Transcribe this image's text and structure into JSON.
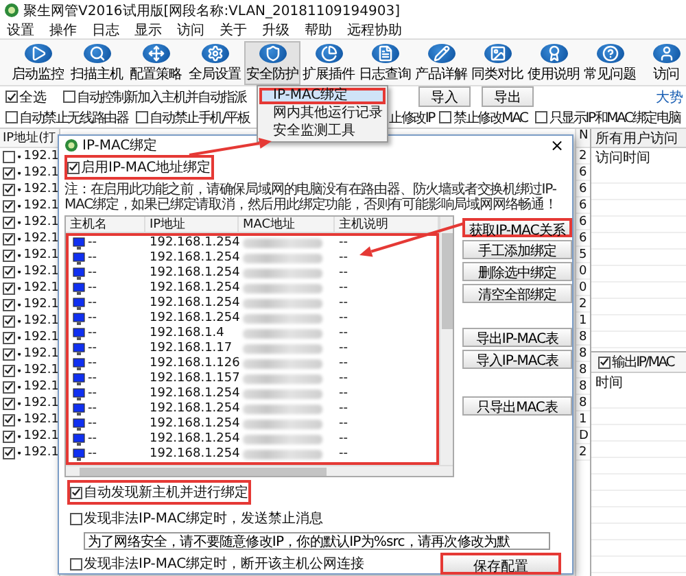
{
  "window": {
    "title": "聚生网管V2016试用版[网段名称:VLAN_20181109194903]"
  },
  "menu": [
    "设置",
    "操作",
    "日志",
    "显示",
    "访问",
    "关于",
    "升级",
    "帮助",
    "远程协助"
  ],
  "toolbar": [
    {
      "label": "启动监控",
      "pressed": false
    },
    {
      "label": "扫描主机",
      "pressed": false
    },
    {
      "label": "配置策略",
      "pressed": false
    },
    {
      "label": "全局设置",
      "pressed": false
    },
    {
      "label": "安全防护",
      "pressed": true
    },
    {
      "label": "扩展插件",
      "pressed": false
    },
    {
      "label": "日志查询",
      "pressed": false
    },
    {
      "label": "产品详解",
      "pressed": false
    },
    {
      "label": "同类对比",
      "pressed": false
    },
    {
      "label": "使用说明",
      "pressed": false
    },
    {
      "label": "常见问题",
      "pressed": false
    },
    {
      "label": "访问",
      "pressed": false
    }
  ],
  "dropdown_menu": [
    {
      "label": "IP-MAC绑定",
      "selected": true,
      "highlighted": true
    },
    {
      "label": "网内其他运行记录",
      "selected": false,
      "highlighted": false
    },
    {
      "label": "安全监测工具",
      "selected": false,
      "highlighted": false
    }
  ],
  "filter_row": {
    "select_all": {
      "label": "全选",
      "checked": true
    },
    "auto_assign": {
      "label": "自动控制新加入主机并自动指派",
      "checked": false
    },
    "buttons": [
      "导入",
      "导出"
    ],
    "link": "大势"
  },
  "option_row": [
    {
      "kind": "checkbox",
      "label": "自动禁止无线路由器",
      "checked": false
    },
    {
      "kind": "checkbox",
      "label": "自动禁止手机/平板",
      "checked": false
    },
    {
      "kind": "text",
      "label": "止修改IP"
    },
    {
      "kind": "checkbox",
      "label": "禁止修改MAC",
      "checked": false
    },
    {
      "kind": "checkbox",
      "label": "只显示IP和MAC绑定电脑",
      "checked": false
    }
  ],
  "host_list": {
    "header": "IP地址(打",
    "rows": [
      {
        "checked": false,
        "ip": "192.1"
      },
      {
        "checked": true,
        "ip": "192.1"
      },
      {
        "checked": true,
        "ip": "192.1"
      },
      {
        "checked": true,
        "ip": "192.1"
      },
      {
        "checked": true,
        "ip": "192.1"
      },
      {
        "checked": true,
        "ip": "192.1"
      },
      {
        "checked": true,
        "ip": "192.1"
      },
      {
        "checked": true,
        "ip": "192.1"
      },
      {
        "checked": true,
        "ip": "192.1"
      },
      {
        "checked": true,
        "ip": "192.1"
      },
      {
        "checked": true,
        "ip": "192.1"
      },
      {
        "checked": true,
        "ip": "192.1"
      },
      {
        "checked": true,
        "ip": "192.1"
      },
      {
        "checked": true,
        "ip": "192.1"
      },
      {
        "checked": true,
        "ip": "192.1"
      },
      {
        "checked": true,
        "ip": "192.1"
      },
      {
        "checked": true,
        "ip": "192.1"
      },
      {
        "checked": true,
        "ip": "192.1"
      },
      {
        "checked": true,
        "ip": "192.1"
      }
    ]
  },
  "column_3": {
    "header": "N",
    "cells": [
      "2",
      "6",
      "6",
      "6",
      "6",
      "6",
      "5",
      "0",
      "0",
      "2",
      "1",
      "8",
      "8",
      "8",
      "8",
      "8",
      "1",
      "D",
      "2"
    ]
  },
  "right_panel": {
    "header": "所有用户访问",
    "column": "访问时间",
    "checkbox": {
      "label": "输出IP/MAC",
      "checked": true
    },
    "column_2": "时间"
  },
  "dialog": {
    "title": "IP-MAC绑定",
    "close": "×",
    "enable": {
      "label": "启用IP-MAC地址绑定",
      "checked": true,
      "highlighted": true
    },
    "note": "注：在启用此功能之前，请确保局域网的电脑没有在路由器、防火墙或者交换机绑过IP-MAC绑定，如果已绑定请取消，然后用此绑定功能，否则有可能影响局域网网络畅通！",
    "table": {
      "highlighted": true,
      "columns": [
        "主机名",
        "IP地址",
        "MAC地址",
        "主机说明"
      ],
      "rows": [
        {
          "host": "--",
          "ip": "192.168.1.254",
          "note": "--"
        },
        {
          "host": "--",
          "ip": "192.168.1.254",
          "note": "--"
        },
        {
          "host": "--",
          "ip": "192.168.1.254",
          "note": "--"
        },
        {
          "host": "--",
          "ip": "192.168.1.254",
          "note": "--"
        },
        {
          "host": "--",
          "ip": "192.168.1.254",
          "note": "--"
        },
        {
          "host": "--",
          "ip": "192.168.1.254",
          "note": "--"
        },
        {
          "host": "--",
          "ip": "192.168.1.4",
          "note": "--"
        },
        {
          "host": "--",
          "ip": "192.168.1.17",
          "note": "--"
        },
        {
          "host": "--",
          "ip": "192.168.1.126",
          "note": "--"
        },
        {
          "host": "--",
          "ip": "192.168.1.157",
          "note": "--"
        },
        {
          "host": "--",
          "ip": "192.168.1.254",
          "note": "--"
        },
        {
          "host": "--",
          "ip": "192.168.1.254",
          "note": "--"
        },
        {
          "host": "--",
          "ip": "192.168.1.254",
          "note": "--"
        },
        {
          "host": "--",
          "ip": "192.168.1.254",
          "note": "--"
        },
        {
          "host": "--",
          "ip": "192.168.1.254",
          "note": "--"
        }
      ]
    },
    "buttons": [
      {
        "label": "获取IP-MAC关系",
        "highlighted": true
      },
      {
        "label": "手工添加绑定",
        "highlighted": false
      },
      {
        "label": "删除选中绑定",
        "highlighted": false
      },
      {
        "label": "清空全部绑定",
        "highlighted": false
      },
      {
        "label": "导出IP-MAC表",
        "highlighted": false
      },
      {
        "label": "导入IP-MAC表",
        "highlighted": false
      },
      {
        "label": "只导出MAC表",
        "highlighted": false
      }
    ],
    "options": [
      {
        "label": "自动发现新主机并进行绑定",
        "checked": true,
        "highlighted": true
      },
      {
        "label": "发现非法IP-MAC绑定时，发送禁止消息",
        "checked": false,
        "highlighted": false,
        "value": "为了网络安全，请不要随意修改IP，你的默认IP为%src，请再次修改为默"
      },
      {
        "label": "发现非法IP-MAC绑定时，断开该主机公网连接",
        "checked": false,
        "highlighted": false
      }
    ],
    "save": {
      "label": "保存配置",
      "highlighted": true
    }
  }
}
